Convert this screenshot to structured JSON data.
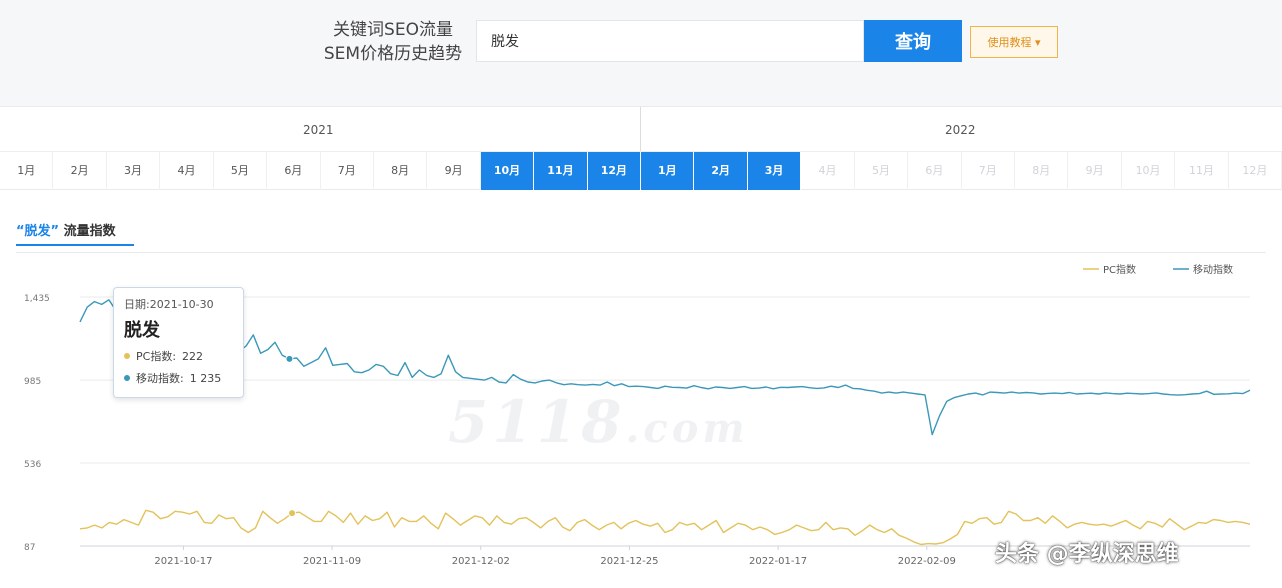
{
  "header": {
    "title_line1": "关键词SEO流量",
    "title_line2": "SEM价格历史趋势",
    "search_value": "脱发",
    "query_label": "查询",
    "tutorial_label": "使用教程 ▾"
  },
  "timeline": {
    "years": [
      "2021",
      "2022"
    ],
    "months": [
      {
        "label": "1月",
        "state": "normal"
      },
      {
        "label": "2月",
        "state": "normal"
      },
      {
        "label": "3月",
        "state": "normal"
      },
      {
        "label": "4月",
        "state": "normal"
      },
      {
        "label": "5月",
        "state": "normal"
      },
      {
        "label": "6月",
        "state": "normal"
      },
      {
        "label": "7月",
        "state": "normal"
      },
      {
        "label": "8月",
        "state": "normal"
      },
      {
        "label": "9月",
        "state": "normal"
      },
      {
        "label": "10月",
        "state": "active"
      },
      {
        "label": "11月",
        "state": "active"
      },
      {
        "label": "12月",
        "state": "active"
      },
      {
        "label": "1月",
        "state": "active"
      },
      {
        "label": "2月",
        "state": "active"
      },
      {
        "label": "3月",
        "state": "active"
      },
      {
        "label": "4月",
        "state": "disabled"
      },
      {
        "label": "5月",
        "state": "disabled"
      },
      {
        "label": "6月",
        "state": "disabled"
      },
      {
        "label": "7月",
        "state": "disabled"
      },
      {
        "label": "8月",
        "state": "disabled"
      },
      {
        "label": "9月",
        "state": "disabled"
      },
      {
        "label": "10月",
        "state": "disabled"
      },
      {
        "label": "11月",
        "state": "disabled"
      },
      {
        "label": "12月",
        "state": "disabled"
      }
    ]
  },
  "chart_tab": {
    "keyword": "“脱发”",
    "suffix": " 流量指数"
  },
  "tooltip": {
    "date": "日期:2021-10-30",
    "keyword": "脱发",
    "pc_label": "PC指数:",
    "pc_value": "222",
    "mobile_label": "移动指数:",
    "mobile_value": "1 235"
  },
  "watermark": {
    "main": "5118",
    "suffix": ".com"
  },
  "attribution": "头条 @李纵深思维",
  "colors": {
    "accent": "#1a84e8",
    "mobile": "#3a98b9",
    "pc": "#e3c25a"
  },
  "chart_data": {
    "type": "line",
    "yticks": [
      "1,435",
      "985",
      "536",
      "87"
    ],
    "ytick_values": [
      1435,
      985,
      536,
      87
    ],
    "ylim": [
      87,
      1435
    ],
    "xticks": [
      "2021-10-17",
      "2021-11-09",
      "2021-12-02",
      "2021-12-25",
      "2022-01-17",
      "2022-02-09"
    ],
    "x_start": "2021-10-01",
    "x_end": "2022-03-31",
    "legend": [
      "PC指数",
      "移动指数"
    ],
    "legend_position": "top-right",
    "series": [
      {
        "name": "移动指数",
        "values": [
          1300,
          1380,
          1410,
          1395,
          1420,
          1360,
          1310,
          1380,
          1370,
          1395,
          1325,
          1300,
          1245,
          1235,
          1260,
          1240,
          1220,
          1180,
          940,
          1250,
          1260,
          1150,
          1140,
          1170,
          1230,
          1130,
          1150,
          1190,
          1120,
          1100,
          1105,
          1060,
          1080,
          1100,
          1160,
          1065,
          1070,
          1075,
          1030,
          1025,
          1040,
          1070,
          1060,
          1020,
          1010,
          1080,
          1000,
          1040,
          1010,
          1000,
          1020,
          1120,
          1030,
          1000,
          995,
          990,
          985,
          1000,
          975,
          970,
          1015,
          990,
          975,
          970,
          980,
          985,
          970,
          960,
          965,
          960,
          958,
          962,
          958,
          975,
          955,
          965,
          950,
          952,
          950,
          945,
          940,
          952,
          946,
          945,
          942,
          955,
          945,
          938,
          948,
          945,
          940,
          945,
          950,
          940,
          942,
          948,
          938,
          946,
          945,
          948,
          950,
          944,
          940,
          943,
          952,
          945,
          958,
          940,
          938,
          930,
          925,
          915,
          920,
          915,
          920,
          915,
          910,
          905,
          690,
          790,
          870,
          890,
          900,
          910,
          915,
          905,
          920,
          918,
          915,
          920,
          915,
          918,
          916,
          910,
          913,
          915,
          912,
          918,
          910,
          912,
          914,
          910,
          916,
          912,
          910,
          914,
          912,
          910,
          912,
          916,
          910,
          906,
          904,
          906,
          910,
          912,
          925,
          908,
          910,
          911,
          915,
          912,
          930
        ]
      },
      {
        "name": "PC指数",
        "values": [
          180,
          185,
          200,
          185,
          215,
          205,
          230,
          215,
          200,
          280,
          270,
          235,
          245,
          275,
          270,
          260,
          275,
          215,
          210,
          255,
          235,
          240,
          185,
          160,
          185,
          275,
          240,
          210,
          235,
          265,
          270,
          245,
          220,
          220,
          275,
          250,
          215,
          265,
          205,
          250,
          225,
          235,
          270,
          190,
          240,
          220,
          220,
          250,
          210,
          180,
          265,
          235,
          200,
          225,
          250,
          240,
          200,
          250,
          215,
          205,
          235,
          240,
          215,
          185,
          220,
          240,
          190,
          170,
          215,
          230,
          200,
          175,
          200,
          215,
          180,
          210,
          225,
          205,
          195,
          210,
          160,
          175,
          215,
          200,
          210,
          175,
          200,
          225,
          160,
          185,
          210,
          200,
          175,
          190,
          175,
          150,
          160,
          175,
          200,
          185,
          170,
          175,
          215,
          175,
          185,
          180,
          145,
          170,
          200,
          175,
          160,
          180,
          145,
          130,
          110,
          95,
          100,
          98,
          105,
          125,
          150,
          220,
          210,
          235,
          240,
          205,
          215,
          275,
          260,
          225,
          225,
          240,
          210,
          250,
          220,
          185,
          205,
          215,
          205,
          200,
          205,
          195,
          210,
          225,
          200,
          180,
          220,
          210,
          190,
          235,
          205,
          175,
          195,
          215,
          210,
          230,
          225,
          215,
          220,
          215,
          205
        ]
      }
    ]
  }
}
